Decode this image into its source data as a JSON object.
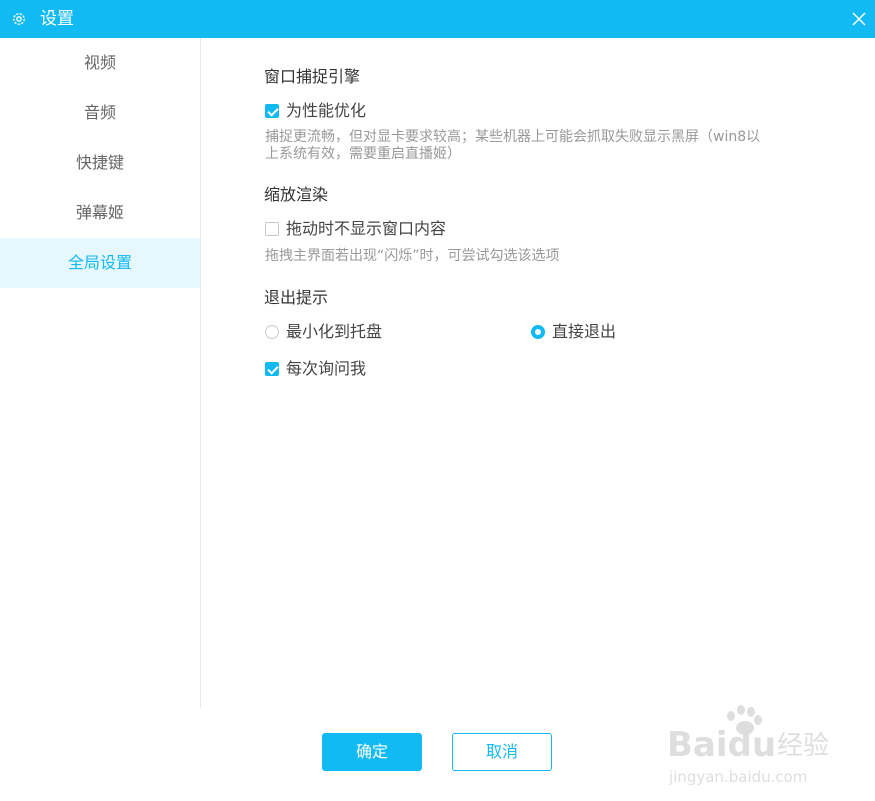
{
  "window": {
    "title": "设置",
    "accent": "#12baf3",
    "icons": {
      "settings": "gear-icon",
      "close": "close-icon"
    }
  },
  "sidebar": {
    "items": [
      {
        "label": "视频",
        "active": false
      },
      {
        "label": "音频",
        "active": false
      },
      {
        "label": "快捷键",
        "active": false
      },
      {
        "label": "弹幕姬",
        "active": false
      },
      {
        "label": "全局设置",
        "active": true
      }
    ]
  },
  "sections": {
    "capture": {
      "title": "窗口捕捉引擎",
      "option_label": "为性能优化",
      "option_checked": true,
      "description_line1": "捕捉更流畅，但对显卡要求较高；某些机器上可能会抓取失败显示黑屏（win8以",
      "description_line2": "上系统有效，需要重启直播姬）"
    },
    "scaling": {
      "title": "缩放渲染",
      "option_label": "拖动时不显示窗口内容",
      "option_checked": false,
      "description": "拖拽主界面若出现“闪烁”时，可尝试勾选该选项"
    },
    "exit": {
      "title": "退出提示",
      "radio_minimize": "最小化到托盘",
      "radio_exit": "直接退出",
      "selected": "直接退出",
      "ask_label": "每次询问我",
      "ask_checked": true
    }
  },
  "footer": {
    "ok": "确定",
    "cancel": "取消"
  },
  "watermark": {
    "brand": "Baidu",
    "brand_cn": "经验",
    "url": "jingyan.baidu.com"
  }
}
